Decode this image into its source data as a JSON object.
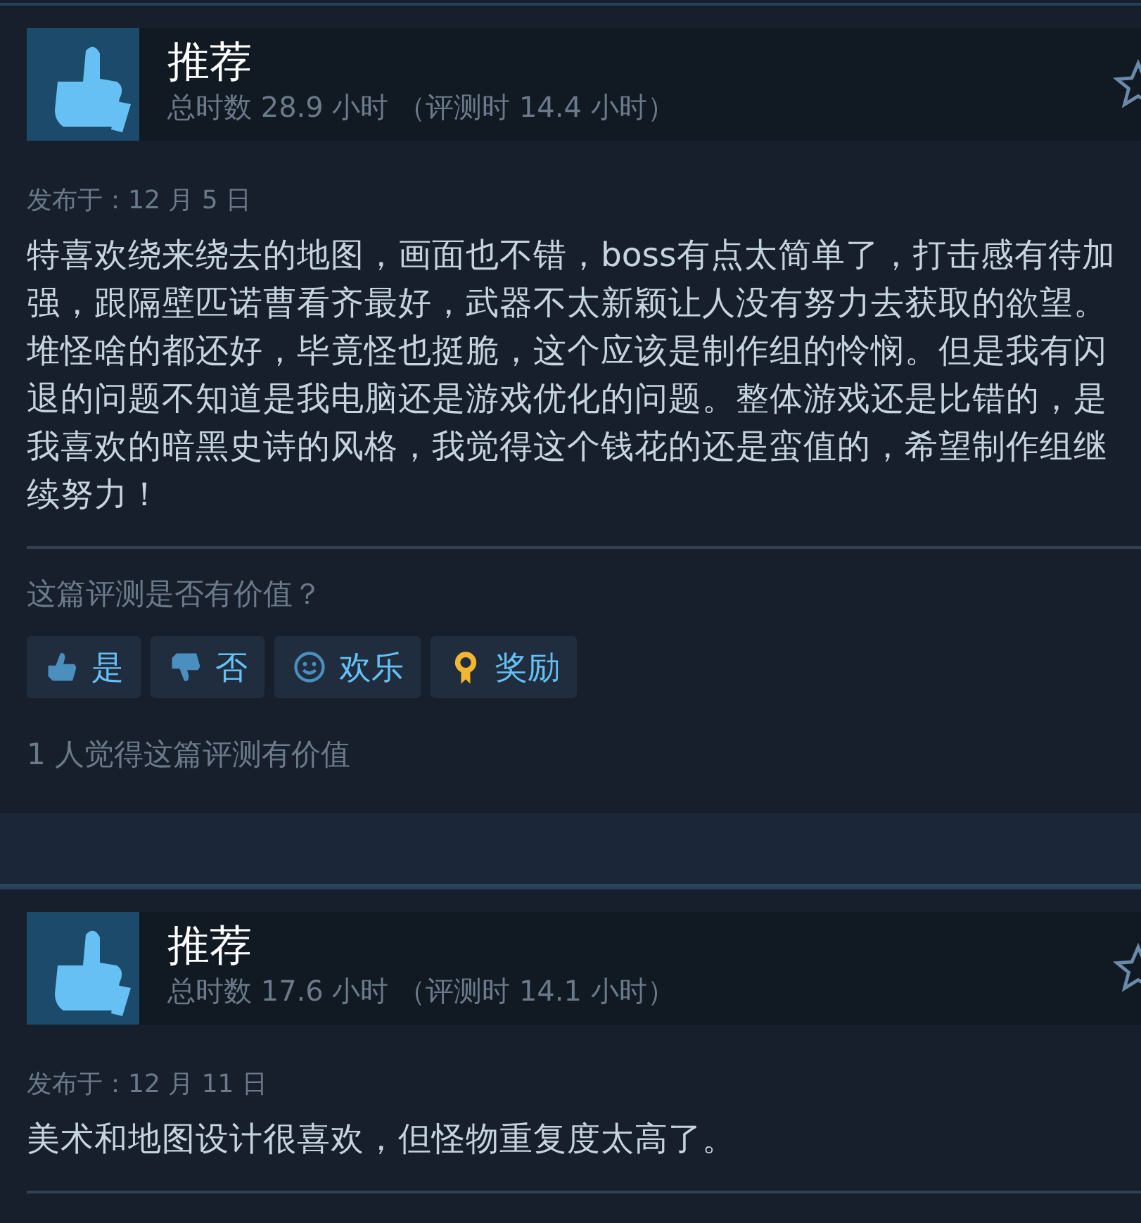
{
  "reviews": [
    {
      "verdict": "推荐",
      "hours": "总时数 28.9 小时 （评测时 14.4 小时）",
      "posted": "发布于：12 月 5 日",
      "body": "特喜欢绕来绕去的地图，画面也不错，boss有点太简单了，打击感有待加强，跟隔壁匹诺曹看齐最好，武器不太新颖让人没有努力去获取的欲望。堆怪啥的都还好，毕竟怪也挺脆，这个应该是制作组的怜悯。但是我有闪退的问题不知道是我电脑还是游戏优化的问题。整体游戏还是比错的，是我喜欢的暗黑史诗的风格，我觉得这个钱花的还是蛮值的，希望制作组继续努力！",
      "question": "这篇评测是否有价值？",
      "buttons": [
        {
          "kind": "yes",
          "label": "是"
        },
        {
          "kind": "no",
          "label": "否"
        },
        {
          "kind": "funny",
          "label": "欢乐"
        },
        {
          "kind": "award",
          "label": "奖励"
        }
      ],
      "helpful": "1 人觉得这篇评测有价值"
    },
    {
      "verdict": "推荐",
      "hours": "总时数 17.6 小时 （评测时 14.1 小时）",
      "posted": "发布于：12 月 11 日",
      "body": "美术和地图设计很喜欢，但怪物重复度太高了。"
    }
  ]
}
